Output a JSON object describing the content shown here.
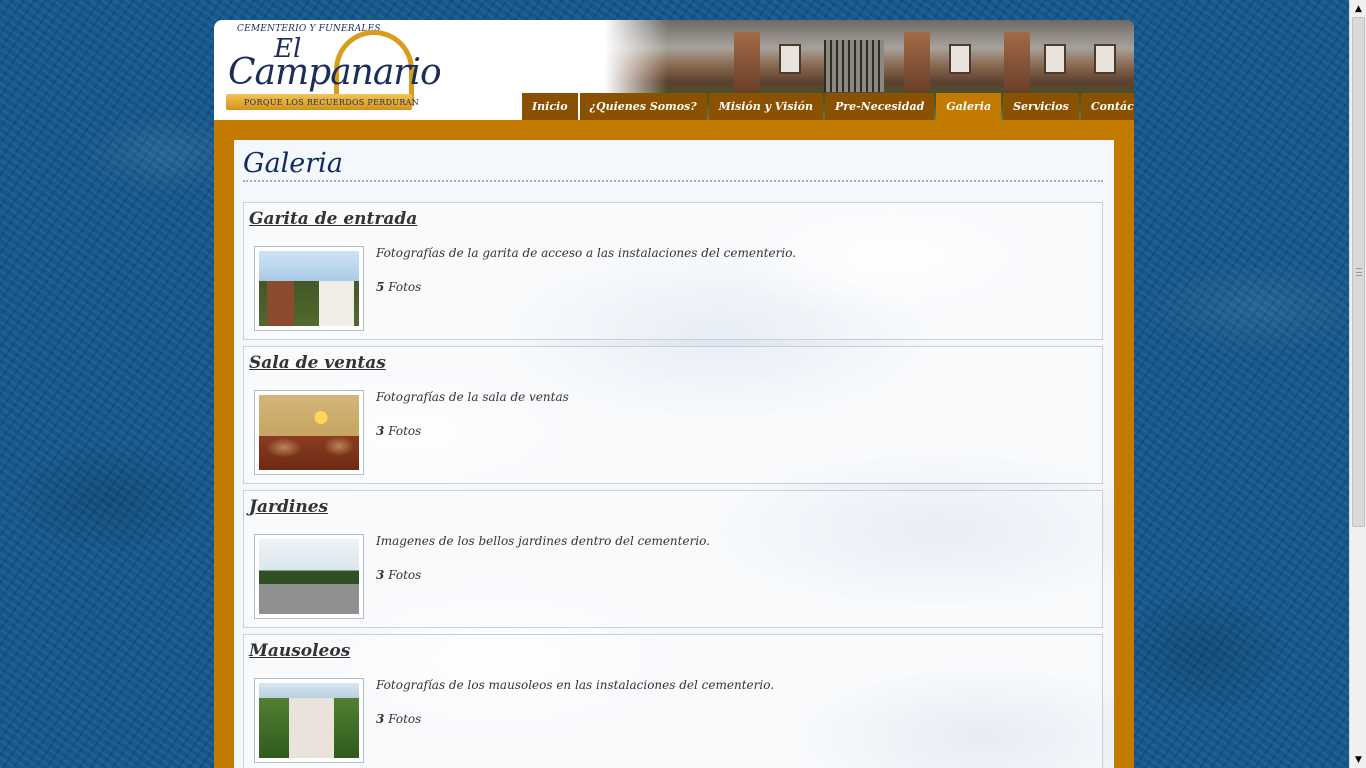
{
  "logo": {
    "top_text": "CEMENTERIO Y FUNERALES",
    "el_text": "El",
    "name": "Campanario",
    "slogan": "PORQUE LOS RECUERDOS PERDURAN"
  },
  "nav": {
    "items": [
      {
        "label": "Inicio"
      },
      {
        "label": "¿Quienes Somos?"
      },
      {
        "label": "Misión y Visión"
      },
      {
        "label": "Pre-Necesidad"
      },
      {
        "label": "Galeria"
      },
      {
        "label": "Servicios"
      },
      {
        "label": "Contáctenos"
      }
    ],
    "active": "Galeria"
  },
  "page": {
    "title": "Galeria"
  },
  "gallery": {
    "albums": [
      {
        "title": "Garita de entrada",
        "description": "Fotografías de la garita de acceso a las instalaciones del cementerio.",
        "count": "5",
        "count_label": "Fotos"
      },
      {
        "title": "Sala de ventas",
        "description": "Fotografías de la sala de ventas",
        "count": "3",
        "count_label": "Fotos"
      },
      {
        "title": "Jardines",
        "description": "Imagenes de los bellos jardines dentro del cementerio.",
        "count": "3",
        "count_label": "Fotos"
      },
      {
        "title": "Mausoleos",
        "description": "Fotografías de los mausoleos en las instalaciones del cementerio.",
        "count": "3",
        "count_label": "Fotos"
      }
    ]
  },
  "colors": {
    "background_blue": "#11548a",
    "frame_gold": "#c27b00",
    "nav_brown": "#8a5100",
    "title_navy": "#0d2b5e"
  }
}
